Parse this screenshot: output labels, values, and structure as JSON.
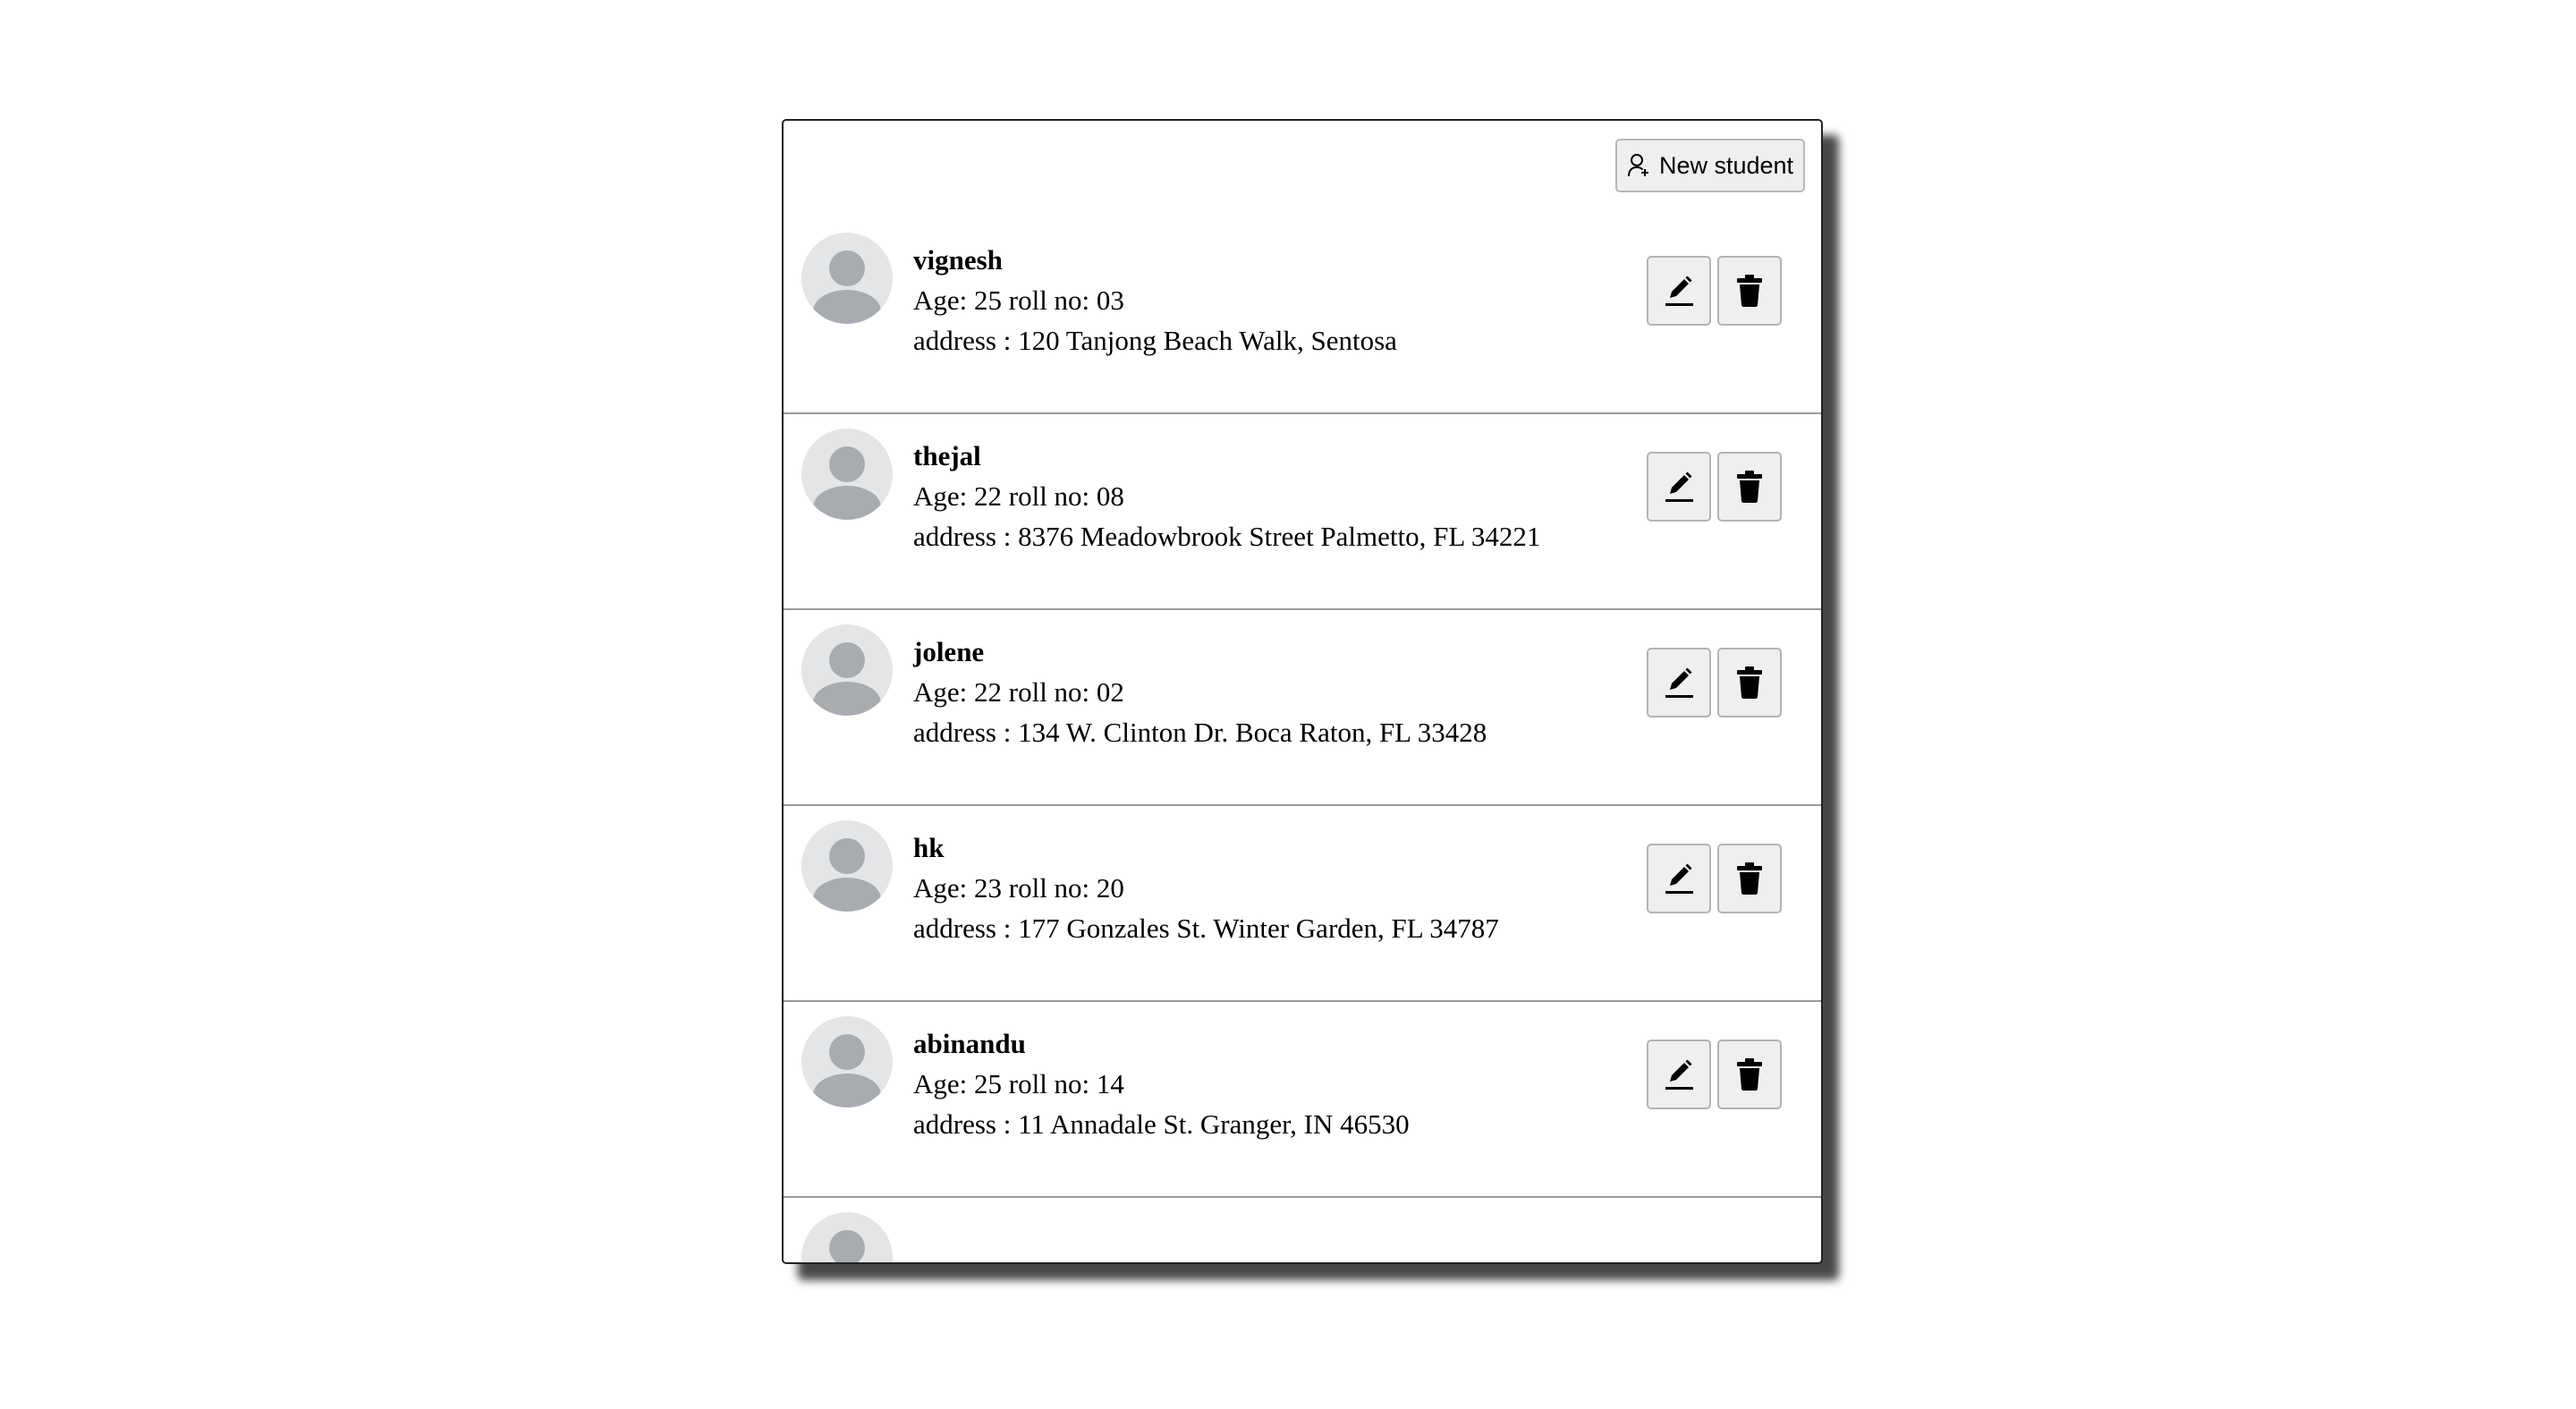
{
  "header": {
    "new_student_label": "New student",
    "new_student_icon": "person-add-icon"
  },
  "students": [
    {
      "name": "vignesh",
      "details": "Age: 25 roll no: 03",
      "address": "address : 120 Tanjong Beach Walk, Sentosa"
    },
    {
      "name": "thejal",
      "details": "Age: 22 roll no: 08",
      "address": "address : 8376 Meadowbrook Street Palmetto, FL 34221"
    },
    {
      "name": "jolene",
      "details": "Age: 22 roll no: 02",
      "address": "address : 134 W. Clinton Dr. Boca Raton, FL 33428"
    },
    {
      "name": "hk",
      "details": "Age: 23 roll no: 20",
      "address": "address : 177 Gonzales St. Winter Garden, FL 34787"
    },
    {
      "name": "abinandu",
      "details": "Age: 25 roll no: 14",
      "address": "address : 11 Annadale St. Granger, IN 46530"
    }
  ],
  "icons": {
    "avatar": "default-avatar-icon",
    "edit": "pencil-icon",
    "delete": "trash-icon"
  },
  "colors": {
    "avatar_background": "#e4e5e7",
    "avatar_figure": "#a8acb1",
    "button_background": "#efefef",
    "panel_border": "#222222"
  }
}
